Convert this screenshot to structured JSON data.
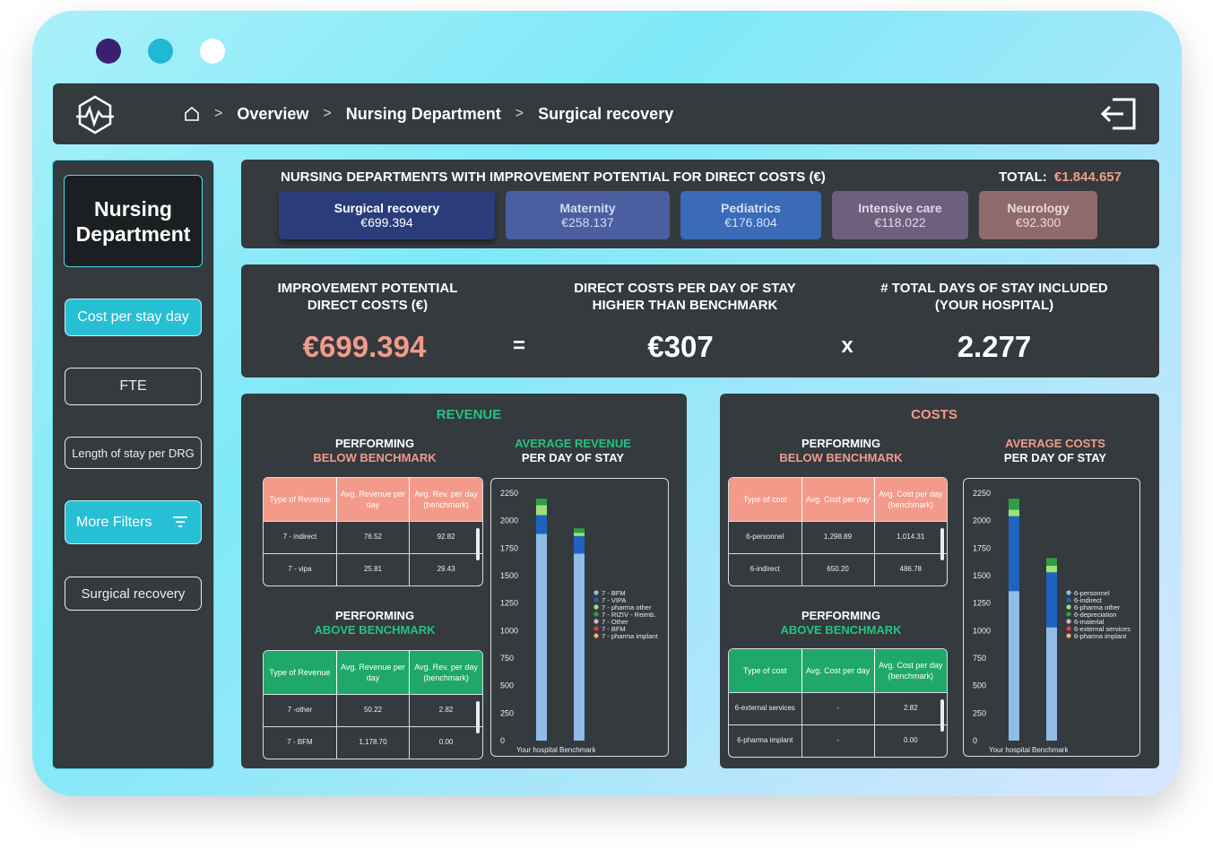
{
  "window_dots": [
    "#3d1f71",
    "#20b8d4",
    "#ffffff"
  ],
  "breadcrumbs": {
    "items": [
      "Overview",
      "Nursing Department",
      "Surgical recovery"
    ],
    "separator": ">"
  },
  "sidebar": {
    "title": "Nursing Department",
    "buttons": [
      "Cost per stay day",
      "FTE",
      "Length of stay per DRG",
      "More Filters",
      "Surgical recovery"
    ]
  },
  "departments": {
    "title": "NURSING DEPARTMENTS WITH IMPROVEMENT POTENTIAL FOR DIRECT COSTS (€)",
    "total_label": "TOTAL:",
    "total_value": "€1.844.657",
    "tiles": [
      {
        "name": "Surgical recovery",
        "value": "€699.394",
        "color": "#2a3d7a"
      },
      {
        "name": "Maternity",
        "value": "€258.137",
        "color": "#4a5ea0"
      },
      {
        "name": "Pediatrics",
        "value": "€176.804",
        "color": "#3a6ab8"
      },
      {
        "name": "Intensive care",
        "value": "€118.022",
        "color": "#6e5f7e"
      },
      {
        "name": "Neurology",
        "value": "€92.300",
        "color": "#8e6a6a"
      }
    ]
  },
  "kpi": {
    "improvement_label": "IMPROVEMENT POTENTIAL DIRECT COSTS (€)",
    "improvement_value": "€699.394",
    "equals": "=",
    "direct_costs_label": "DIRECT COSTS PER DAY OF STAY HIGHER THAN BENCHMARK",
    "direct_costs_value": "€307",
    "times": "x",
    "days_label": "# TOTAL DAYS OF STAY INCLUDED (YOUR HOSPITAL)",
    "days_value": "2.277"
  },
  "revenue": {
    "title": "REVENUE",
    "below_title": "PERFORMING",
    "below_sub": "BELOW BENCHMARK",
    "above_title": "PERFORMING",
    "above_sub": "ABOVE BENCHMARK",
    "avg_title": "AVERAGE REVENUE",
    "avg_sub": "PER DAY OF STAY",
    "headers": [
      "Type of Revenue",
      "Avg. Revenue per day",
      "Avg. Rev. per day (benchmark)"
    ],
    "below_rows": [
      [
        "7 - indirect",
        "76.52",
        "92.82"
      ],
      [
        "7 - vipa",
        "25.81",
        "29.43"
      ]
    ],
    "above_rows": [
      [
        "7 -other",
        "50.22",
        "2.82"
      ],
      [
        "7 - BFM",
        "1,178.70",
        "0.00"
      ]
    ]
  },
  "costs": {
    "title": "COSTS",
    "below_title": "PERFORMING",
    "below_sub": "BELOW BENCHMARK",
    "above_title": "PERFORMING",
    "above_sub": "ABOVE BENCHMARK",
    "avg_title": "AVERAGE COSTS",
    "avg_sub": "PER DAY OF STAY",
    "headers": [
      "Type of cost",
      "Avg. Cost per day",
      "Avg. Cost per day (benchmark)"
    ],
    "below_rows": [
      [
        "6-personnel",
        "1,298.89",
        "1,014.31"
      ],
      [
        "6-indirect",
        "650.20",
        "486.78"
      ]
    ],
    "above_rows": [
      [
        "6-external services",
        "-",
        "2.82"
      ],
      [
        "6-pharma implant",
        "-",
        "0.00"
      ]
    ]
  },
  "colors": {
    "salmon": "#f39a8a",
    "green": "#1fa86a",
    "header_green_text": "#26c281",
    "costs_title": "#f39a8a",
    "cyan_button": "#27bfd3"
  },
  "chart_data": [
    {
      "type": "bar",
      "stacked": true,
      "categories": [
        "Your hospital",
        "Benchmark"
      ],
      "ylim": [
        0,
        2250
      ],
      "yticks": [
        0,
        250,
        500,
        750,
        1000,
        1250,
        1500,
        1750,
        2000,
        2250
      ],
      "legend": "right",
      "series": [
        {
          "name": "7 - BFM",
          "color": "#8fbde6",
          "values": [
            1880,
            1700
          ]
        },
        {
          "name": "7 - VIPA",
          "color": "#1f63c0",
          "values": [
            170,
            160
          ]
        },
        {
          "name": "7 - pharma other",
          "color": "#9ee07a",
          "values": [
            90,
            30
          ]
        },
        {
          "name": "7 - RIZIV - Reimb.",
          "color": "#2e9d43",
          "values": [
            60,
            40
          ]
        },
        {
          "name": "7 - Other",
          "color": "#c0c0c0",
          "values": [
            0,
            0
          ]
        },
        {
          "name": "7 - BFM",
          "color": "#e23c3c",
          "values": [
            0,
            0
          ]
        },
        {
          "name": "7 - pharma implant",
          "color": "#f5b06a",
          "values": [
            0,
            0
          ]
        }
      ]
    },
    {
      "type": "bar",
      "stacked": true,
      "categories": [
        "Your hospital",
        "Benchmark"
      ],
      "ylim": [
        0,
        2250
      ],
      "yticks": [
        0,
        250,
        500,
        750,
        1000,
        1250,
        1500,
        1750,
        2000,
        2250
      ],
      "legend": "right",
      "series": [
        {
          "name": "6-personnel",
          "color": "#8fbde6",
          "values": [
            1360,
            1030
          ]
        },
        {
          "name": "6-indirect",
          "color": "#1f63c0",
          "values": [
            680,
            500
          ]
        },
        {
          "name": "6-pharma other",
          "color": "#9ee07a",
          "values": [
            60,
            60
          ]
        },
        {
          "name": "6-depreciation",
          "color": "#2e9d43",
          "values": [
            100,
            70
          ]
        },
        {
          "name": "6-material",
          "color": "#c0c0c0",
          "values": [
            0,
            0
          ]
        },
        {
          "name": "6-external services",
          "color": "#e23c3c",
          "values": [
            0,
            0
          ]
        },
        {
          "name": "6-pharma implant",
          "color": "#f5b06a",
          "values": [
            0,
            0
          ]
        }
      ]
    }
  ]
}
